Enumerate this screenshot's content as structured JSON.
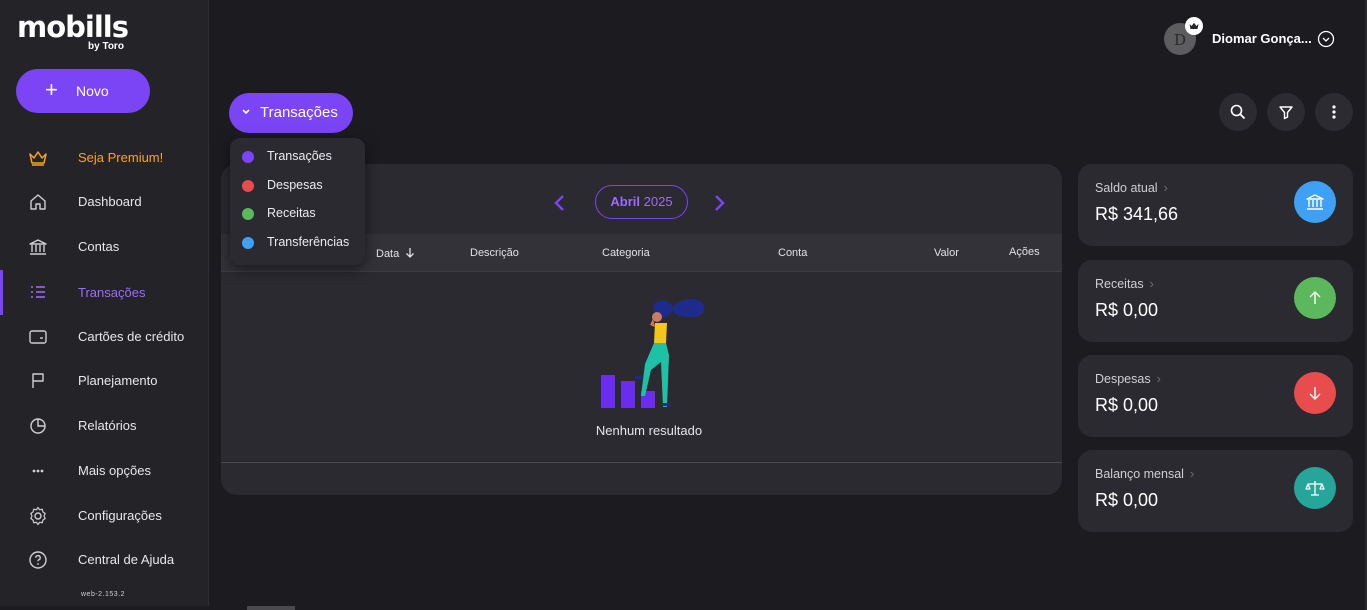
{
  "brand": {
    "name": "mobills",
    "sub": "by Toro"
  },
  "sidebar": {
    "new_button": "Novo",
    "items": [
      {
        "label": "Seja Premium!",
        "icon": "crown-icon"
      },
      {
        "label": "Dashboard",
        "icon": "home-icon"
      },
      {
        "label": "Contas",
        "icon": "bank-icon"
      },
      {
        "label": "Transações",
        "icon": "list-icon"
      },
      {
        "label": "Cartões de crédito",
        "icon": "credit-card-icon"
      },
      {
        "label": "Planejamento",
        "icon": "flag-icon"
      },
      {
        "label": "Relatórios",
        "icon": "pie-chart-icon"
      },
      {
        "label": "Mais opções",
        "icon": "more-horizontal-icon"
      },
      {
        "label": "Configurações",
        "icon": "gear-icon"
      },
      {
        "label": "Central de Ajuda",
        "icon": "help-icon"
      }
    ],
    "version": "web-2.153.2"
  },
  "header": {
    "user_initial": "D",
    "user_name": "Diomar Gonça...",
    "view_button": "Transações"
  },
  "dropdown": {
    "items": [
      {
        "label": "Transações",
        "color": "#7b45f5"
      },
      {
        "label": "Despesas",
        "color": "#e84c4c"
      },
      {
        "label": "Receitas",
        "color": "#5cb85c"
      },
      {
        "label": "Transferências",
        "color": "#3fa1f5"
      }
    ]
  },
  "table": {
    "month": "Abril",
    "year": "2025",
    "columns": [
      "Data",
      "Descrição",
      "Categoria",
      "Conta",
      "Valor",
      "Ações"
    ],
    "empty_text": "Nenhum resultado"
  },
  "summary": [
    {
      "label": "Saldo atual",
      "amount": "R$ 341,66",
      "color": "#3fa1f5",
      "icon": "bank-icon"
    },
    {
      "label": "Receitas",
      "amount": "R$ 0,00",
      "color": "#5cb85c",
      "icon": "arrow-up-icon"
    },
    {
      "label": "Despesas",
      "amount": "R$ 0,00",
      "color": "#e84c4c",
      "icon": "arrow-down-icon"
    },
    {
      "label": "Balanço mensal",
      "amount": "R$ 0,00",
      "color": "#26a69a",
      "icon": "scale-icon"
    }
  ]
}
